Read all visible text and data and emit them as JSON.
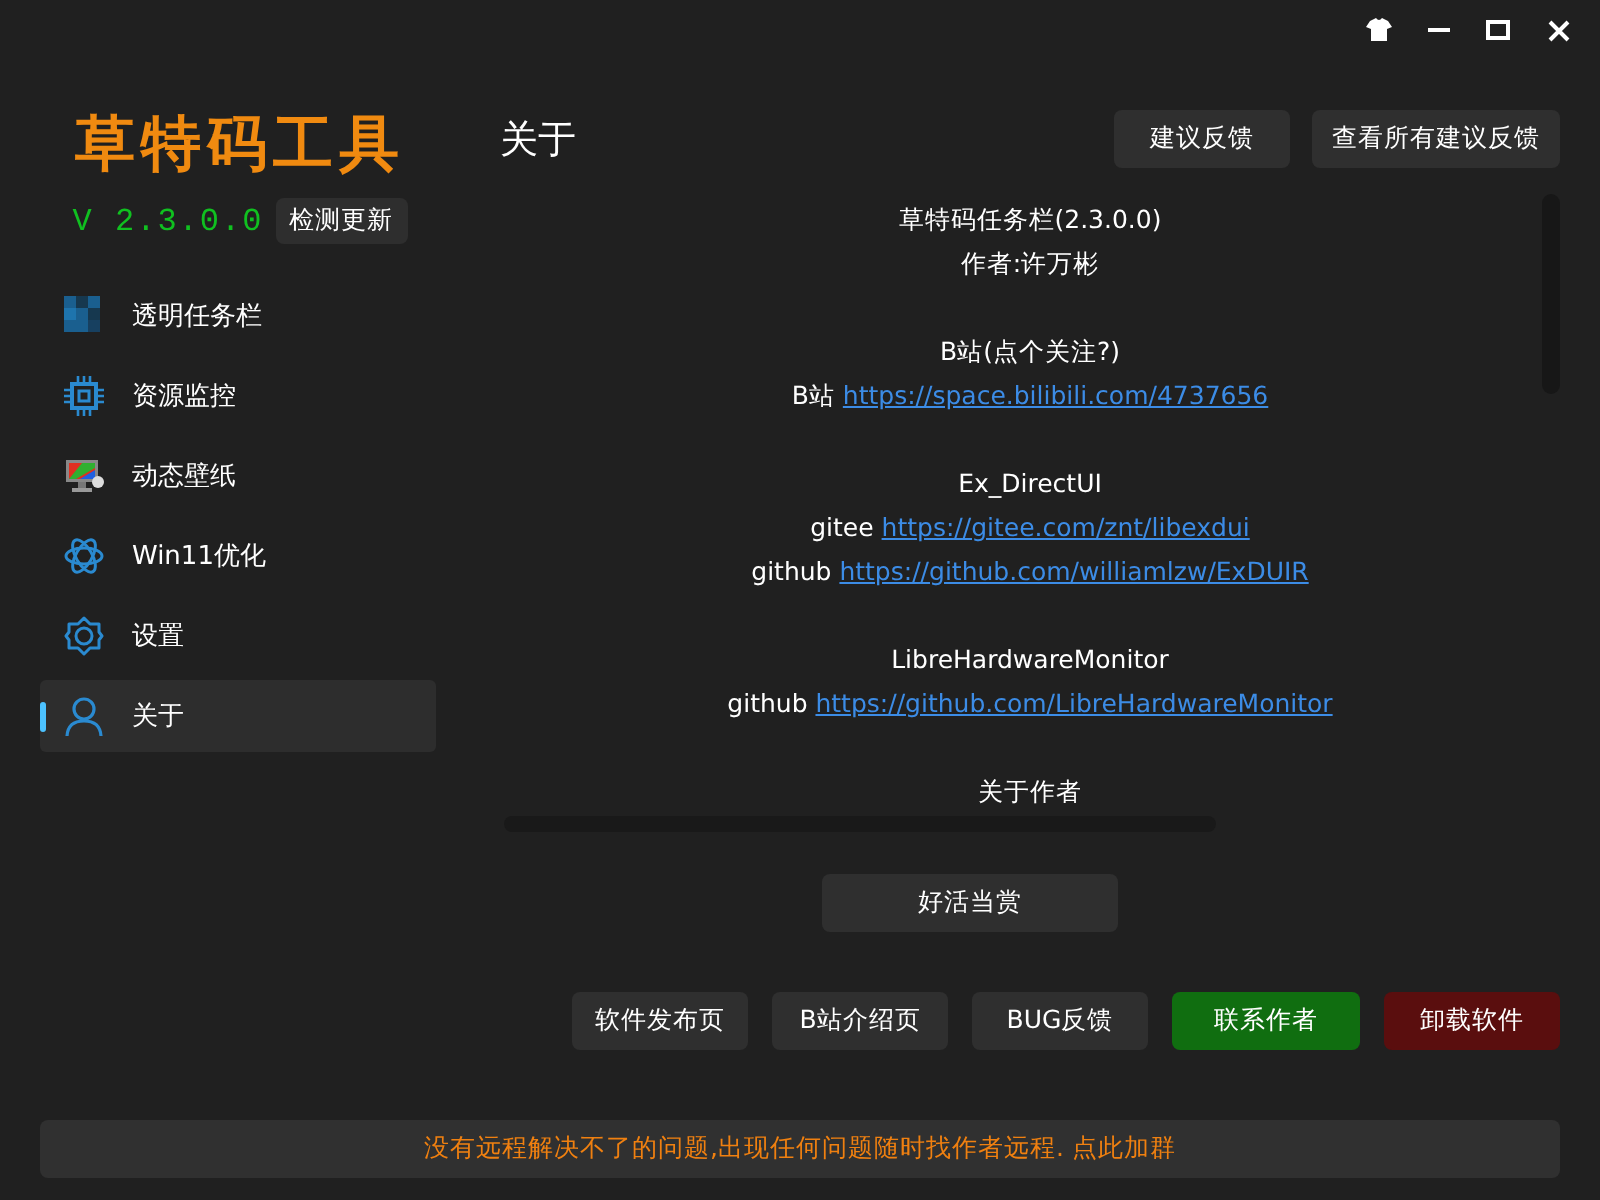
{
  "sidebar": {
    "logo": "草特码工具",
    "version": "V 2.3.0.0",
    "update_button": "检测更新",
    "items": [
      {
        "label": "透明任务栏",
        "selected": false
      },
      {
        "label": "资源监控",
        "selected": false
      },
      {
        "label": "动态壁纸",
        "selected": false
      },
      {
        "label": "Win11优化",
        "selected": false
      },
      {
        "label": "设置",
        "selected": false
      },
      {
        "label": "关于",
        "selected": true
      }
    ]
  },
  "page_title": "关于",
  "header_buttons": [
    "建议反馈",
    "查看所有建议反馈"
  ],
  "about_lines": [
    {
      "kind": "text",
      "text": "草特码任务栏(2.3.0.0)"
    },
    {
      "kind": "text",
      "text": "作者:许万彬"
    },
    {
      "kind": "blank"
    },
    {
      "kind": "text",
      "text": "B站(点个关注?)"
    },
    {
      "kind": "link",
      "label": "B站",
      "url": "https://space.bilibili.com/4737656"
    },
    {
      "kind": "blank"
    },
    {
      "kind": "text",
      "text": "Ex_DirectUI"
    },
    {
      "kind": "link",
      "label": "gitee",
      "url": "https://gitee.com/znt/libexdui"
    },
    {
      "kind": "link",
      "label": "github",
      "url": "https://github.com/williamlzw/ExDUIR"
    },
    {
      "kind": "blank"
    },
    {
      "kind": "text",
      "text": "LibreHardwareMonitor"
    },
    {
      "kind": "link",
      "label": "github",
      "url": "https://github.com/LibreHardwareMonitor"
    },
    {
      "kind": "blank"
    },
    {
      "kind": "text",
      "text": "关于作者"
    }
  ],
  "reward_button": "好活当赏",
  "footer_buttons": [
    {
      "label": "软件发布页",
      "kind": "normal"
    },
    {
      "label": "B站介绍页",
      "kind": "normal"
    },
    {
      "label": "BUG反馈",
      "kind": "normal"
    },
    {
      "label": "联系作者",
      "kind": "primary"
    },
    {
      "label": "卸载软件",
      "kind": "danger"
    }
  ],
  "notice": "没有远程解决不了的问题,出现任何问题随时找作者远程. 点此加群"
}
